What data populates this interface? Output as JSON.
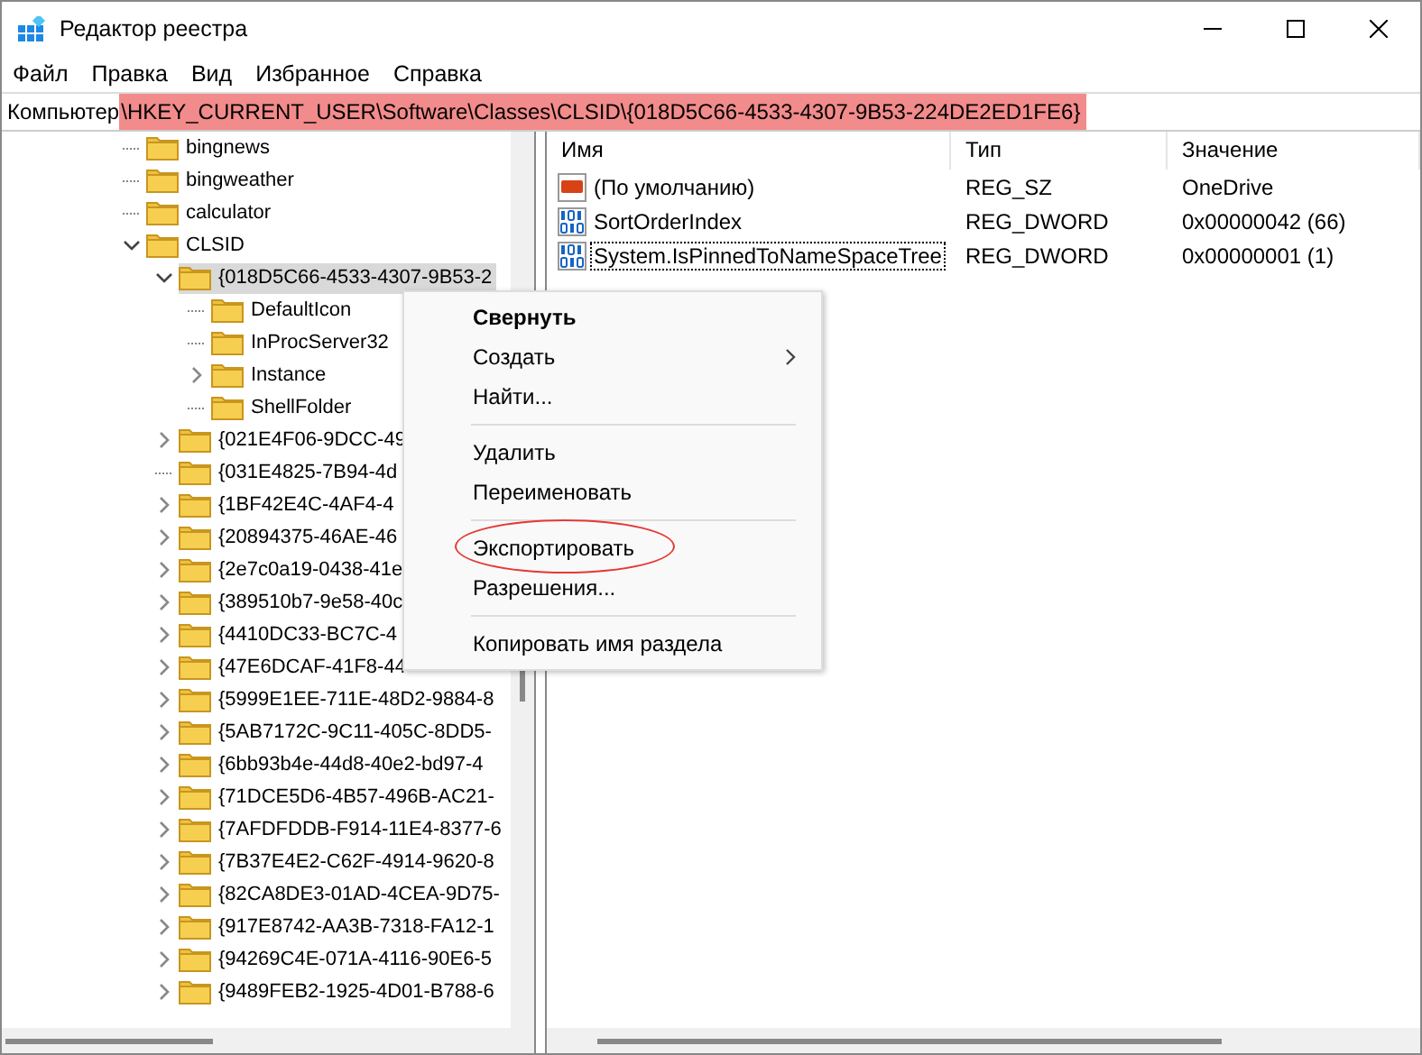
{
  "window": {
    "title": "Редактор реестра"
  },
  "menu_bar": [
    "Файл",
    "Правка",
    "Вид",
    "Избранное",
    "Справка"
  ],
  "address": {
    "root": "Компьютер",
    "path": "\\HKEY_CURRENT_USER\\Software\\Classes\\CLSID\\{018D5C66-4533-4307-9B53-224DE2ED1FE6}",
    "highlighted": true
  },
  "tree": {
    "items": [
      {
        "label": "bingnews",
        "expandable": false,
        "selected": false
      },
      {
        "label": "bingweather",
        "expandable": false,
        "selected": false
      },
      {
        "label": "calculator",
        "expandable": false,
        "selected": false
      },
      {
        "label": "CLSID",
        "expandable": true,
        "expanded": true,
        "selected": false,
        "children": [
          {
            "label": "{018D5C66-4533-4307-9B53-2",
            "expandable": true,
            "expanded": true,
            "selected": true,
            "children": [
              {
                "label": "DefaultIcon",
                "expandable": false,
                "selected": false
              },
              {
                "label": "InProcServer32",
                "expandable": false,
                "selected": false
              },
              {
                "label": "Instance",
                "expandable": true,
                "expanded": false,
                "selected": false
              },
              {
                "label": "ShellFolder",
                "expandable": false,
                "selected": false
              }
            ]
          },
          {
            "label": "{021E4F06-9DCC-49",
            "expandable": true,
            "expanded": false,
            "selected": false
          },
          {
            "label": "{031E4825-7B94-4d",
            "expandable": false,
            "selected": false
          },
          {
            "label": "{1BF42E4C-4AF4-4",
            "expandable": true,
            "expanded": false,
            "selected": false
          },
          {
            "label": "{20894375-46AE-46",
            "expandable": true,
            "expanded": false,
            "selected": false
          },
          {
            "label": "{2e7c0a19-0438-41e",
            "expandable": true,
            "expanded": false,
            "selected": false
          },
          {
            "label": "{389510b7-9e58-40c",
            "expandable": true,
            "expanded": false,
            "selected": false
          },
          {
            "label": "{4410DC33-BC7C-4",
            "expandable": true,
            "expanded": false,
            "selected": false
          },
          {
            "label": "{47E6DCAF-41F8-44",
            "expandable": true,
            "expanded": false,
            "selected": false
          },
          {
            "label": "{5999E1EE-711E-48D2-9884-8",
            "expandable": true,
            "expanded": false,
            "selected": false
          },
          {
            "label": "{5AB7172C-9C11-405C-8DD5-",
            "expandable": true,
            "expanded": false,
            "selected": false
          },
          {
            "label": "{6bb93b4e-44d8-40e2-bd97-4",
            "expandable": true,
            "expanded": false,
            "selected": false
          },
          {
            "label": "{71DCE5D6-4B57-496B-AC21-",
            "expandable": true,
            "expanded": false,
            "selected": false
          },
          {
            "label": "{7AFDFDDB-F914-11E4-8377-6",
            "expandable": true,
            "expanded": false,
            "selected": false
          },
          {
            "label": "{7B37E4E2-C62F-4914-9620-8",
            "expandable": true,
            "expanded": false,
            "selected": false
          },
          {
            "label": "{82CA8DE3-01AD-4CEA-9D75-",
            "expandable": true,
            "expanded": false,
            "selected": false
          },
          {
            "label": "{917E8742-AA3B-7318-FA12-1",
            "expandable": true,
            "expanded": false,
            "selected": false
          },
          {
            "label": "{94269C4E-071A-4116-90E6-5",
            "expandable": true,
            "expanded": false,
            "selected": false
          },
          {
            "label": "{9489FEB2-1925-4D01-B788-6",
            "expandable": true,
            "expanded": false,
            "selected": false
          }
        ]
      }
    ]
  },
  "values": {
    "columns": [
      "Имя",
      "Тип",
      "Значение"
    ],
    "rows": [
      {
        "kind": "string",
        "name": "(По умолчанию)",
        "type": "REG_SZ",
        "data": "OneDrive",
        "focused": false
      },
      {
        "kind": "dword",
        "name": "SortOrderIndex",
        "type": "REG_DWORD",
        "data": "0x00000042 (66)",
        "focused": false
      },
      {
        "kind": "dword",
        "name": "System.IsPinnedToNameSpaceTree",
        "type": "REG_DWORD",
        "data": "0x00000001 (1)",
        "focused": true
      }
    ]
  },
  "context_menu": {
    "items": [
      {
        "kind": "item",
        "label": "Свернуть",
        "default": true,
        "submenu": false,
        "circled": false
      },
      {
        "kind": "item",
        "label": "Создать",
        "default": false,
        "submenu": true,
        "circled": false
      },
      {
        "kind": "item",
        "label": "Найти...",
        "default": false,
        "submenu": false,
        "circled": false
      },
      {
        "kind": "separator"
      },
      {
        "kind": "item",
        "label": "Удалить",
        "default": false,
        "submenu": false,
        "circled": false
      },
      {
        "kind": "item",
        "label": "Переименовать",
        "default": false,
        "submenu": false,
        "circled": false
      },
      {
        "kind": "separator"
      },
      {
        "kind": "item",
        "label": "Экспортировать",
        "default": false,
        "submenu": false,
        "circled": true
      },
      {
        "kind": "item",
        "label": "Разрешения...",
        "default": false,
        "submenu": false,
        "circled": false
      },
      {
        "kind": "separator"
      },
      {
        "kind": "item",
        "label": "Копировать имя раздела",
        "default": false,
        "submenu": false,
        "circled": false
      }
    ]
  }
}
